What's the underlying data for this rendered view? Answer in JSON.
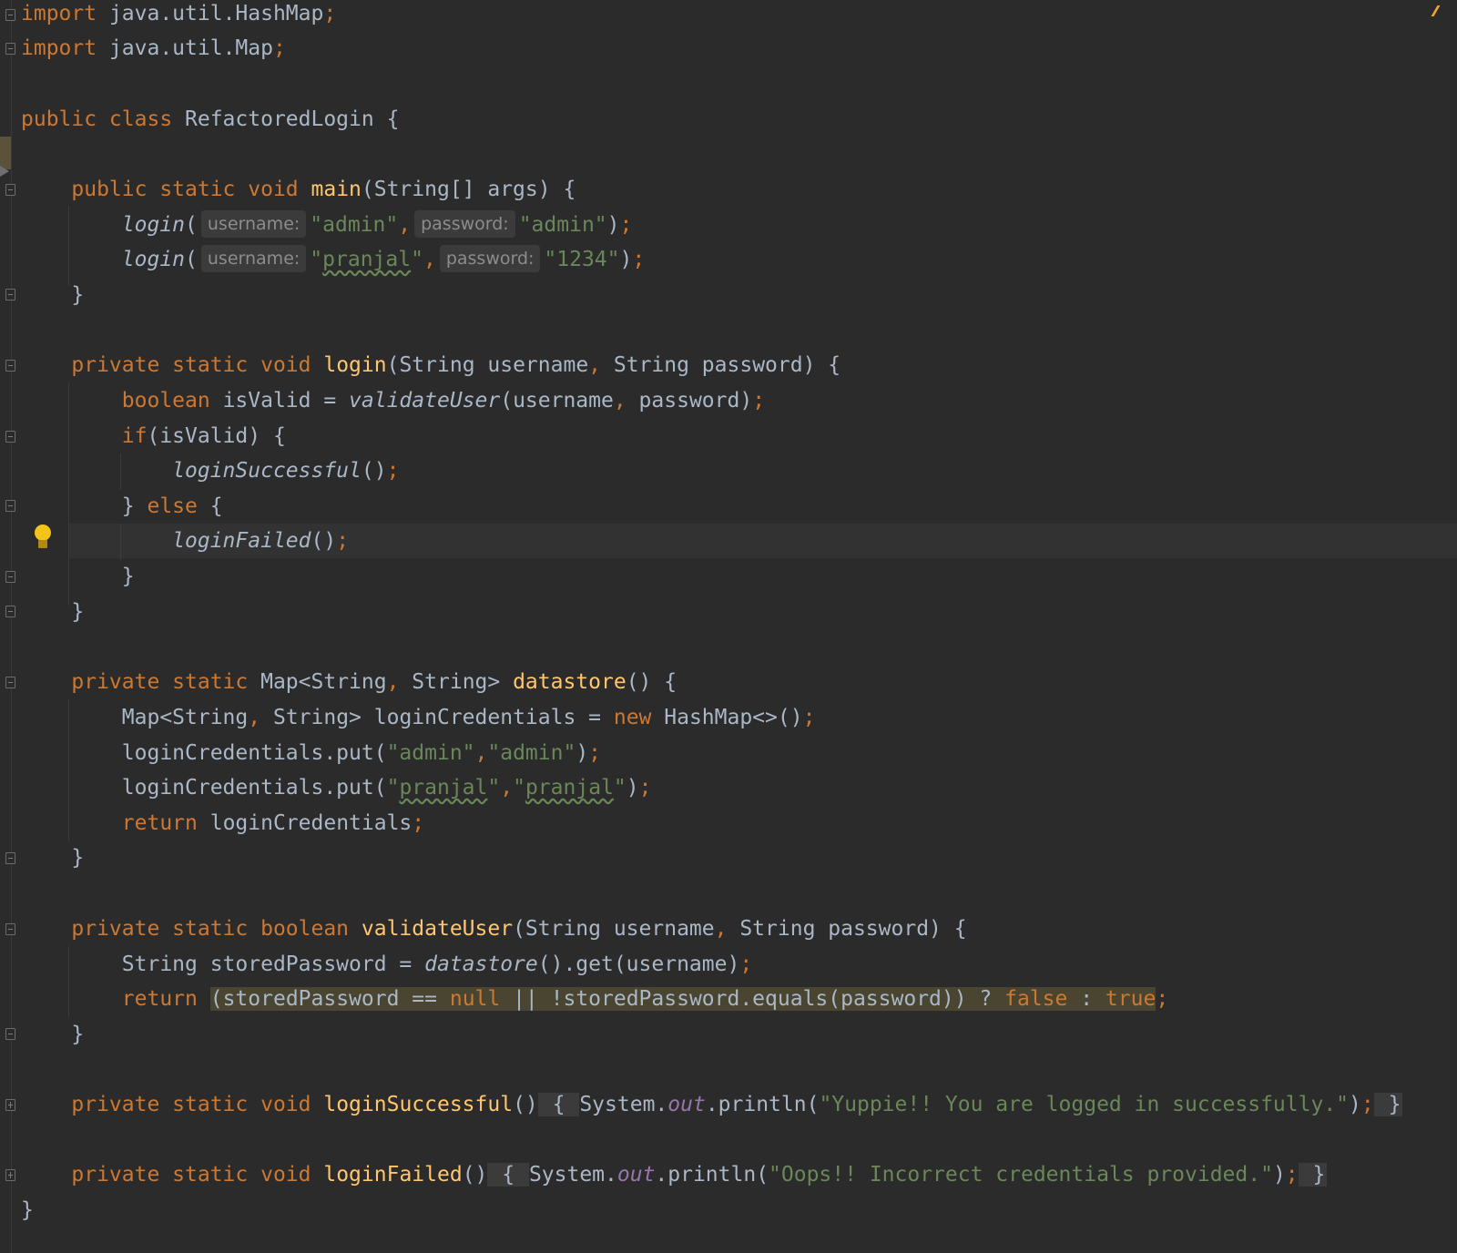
{
  "editor": {
    "lines": {
      "imp1": {
        "kw": "import",
        "rest": " java.util.HashMap",
        "semi": ";"
      },
      "imp2": {
        "kw": "import",
        "rest": " java.util.Map",
        "semi": ";"
      },
      "cls": {
        "kw": "public class",
        "name": " RefactoredLogin {"
      },
      "main_sig": {
        "kw": "public static void",
        "name": "main",
        "params": "(String[] args) {"
      },
      "call1": {
        "name": "login",
        "open": "(",
        "hint_user": "username:",
        "arg1": "\"admin\"",
        "comma": ",",
        "hint_pass": "password:",
        "arg2": "\"admin\"",
        "close": ")",
        "semi": ";"
      },
      "call2": {
        "name": "login",
        "open": "(",
        "hint_user": "username:",
        "arg1_q1": "\"",
        "arg1_word": "pranjal",
        "arg1_q2": "\"",
        "comma": ",",
        "hint_pass": "password:",
        "arg2": "\"1234\"",
        "close": ")",
        "semi": ";"
      },
      "main_close": "}",
      "login_sig": {
        "kw": "private static void",
        "name": "login",
        "p1": "(String username",
        "comma": ",",
        "p2": " String password) {"
      },
      "valid": {
        "kw": "boolean",
        "mid": " isValid = ",
        "call": "validateUser",
        "args": "(username",
        "comma": ",",
        "args2": " password)",
        "semi": ";"
      },
      "if": {
        "kw": "if",
        "rest": "(isValid) {"
      },
      "succ": {
        "call": "loginSuccessful",
        "rest": "()",
        "semi": ";"
      },
      "else": {
        "brace": "} ",
        "kw": "else",
        "rest": " {"
      },
      "fail": {
        "call": "loginFailed",
        "rest": "()",
        "semi": ";"
      },
      "if_close": "}",
      "login_close": "}",
      "ds_sig": {
        "kw": "private static",
        "type": " Map<String",
        "comma": ",",
        "type2": " String> ",
        "name": "datastore",
        "rest": "() {"
      },
      "ds_map": {
        "t1": "Map<String",
        "comma": ",",
        "t2": " String> loginCredentials = ",
        "kw": "new",
        "rest": " HashMap<>()",
        "semi": ";"
      },
      "ds_put1": {
        "pre": "loginCredentials.put(",
        "s1": "\"admin\"",
        "comma": ",",
        "s2": "\"admin\"",
        "close": ")",
        "semi": ";"
      },
      "ds_put2": {
        "pre": "loginCredentials.put(",
        "q": "\"",
        "w1": "pranjal",
        "comma": ",",
        "w2": "pranjal",
        "close": ")",
        "semi": ";"
      },
      "ds_ret": {
        "kw": "return",
        "rest": " loginCredentials",
        "semi": ";"
      },
      "ds_close": "}",
      "vu_sig": {
        "kw": "private static boolean",
        "name": "validateUser",
        "p1": "(String username",
        "comma": ",",
        "p2": " String password) {"
      },
      "vu_stored": {
        "pre": "String storedPassword = ",
        "call": "datastore",
        "rest": "().get(username)",
        "semi": ";"
      },
      "vu_ret": {
        "kw": "return",
        "h1": "(storedPassword == ",
        "null": "null",
        "h2": " || !storedPassword.equals(password)) ? ",
        "false": "false",
        "colon": " : ",
        "true": "true",
        "semi": ";"
      },
      "vu_close": "}",
      "ls_sig": {
        "kw": "private static void",
        "name": "loginSuccessful",
        "paren": "()",
        "ob": " { ",
        "sys": "System.",
        "out": "out",
        "pr": ".println(",
        "msg": "\"Yuppie!! You are logged in successfully.\"",
        "close": ")",
        "semi": ";",
        "cb": " }"
      },
      "lf_sig": {
        "kw": "private static void",
        "name": "loginFailed",
        "paren": "()",
        "ob": " { ",
        "sys": "System.",
        "out": "out",
        "pr": ".println(",
        "msg": "\"Oops!! Incorrect credentials provided.\"",
        "close": ")",
        "semi": ";",
        "cb": " }"
      },
      "cls_close": "}"
    },
    "colors": {
      "background": "#2b2b2b",
      "keyword": "#cc7832",
      "function": "#ffc66d",
      "string": "#6a8759",
      "text": "#a9b7c6",
      "number": "#6897bb",
      "field": "#9876aa"
    },
    "icons": [
      "fold-icon",
      "lightbulb-icon",
      "caret-arrow-icon"
    ]
  }
}
